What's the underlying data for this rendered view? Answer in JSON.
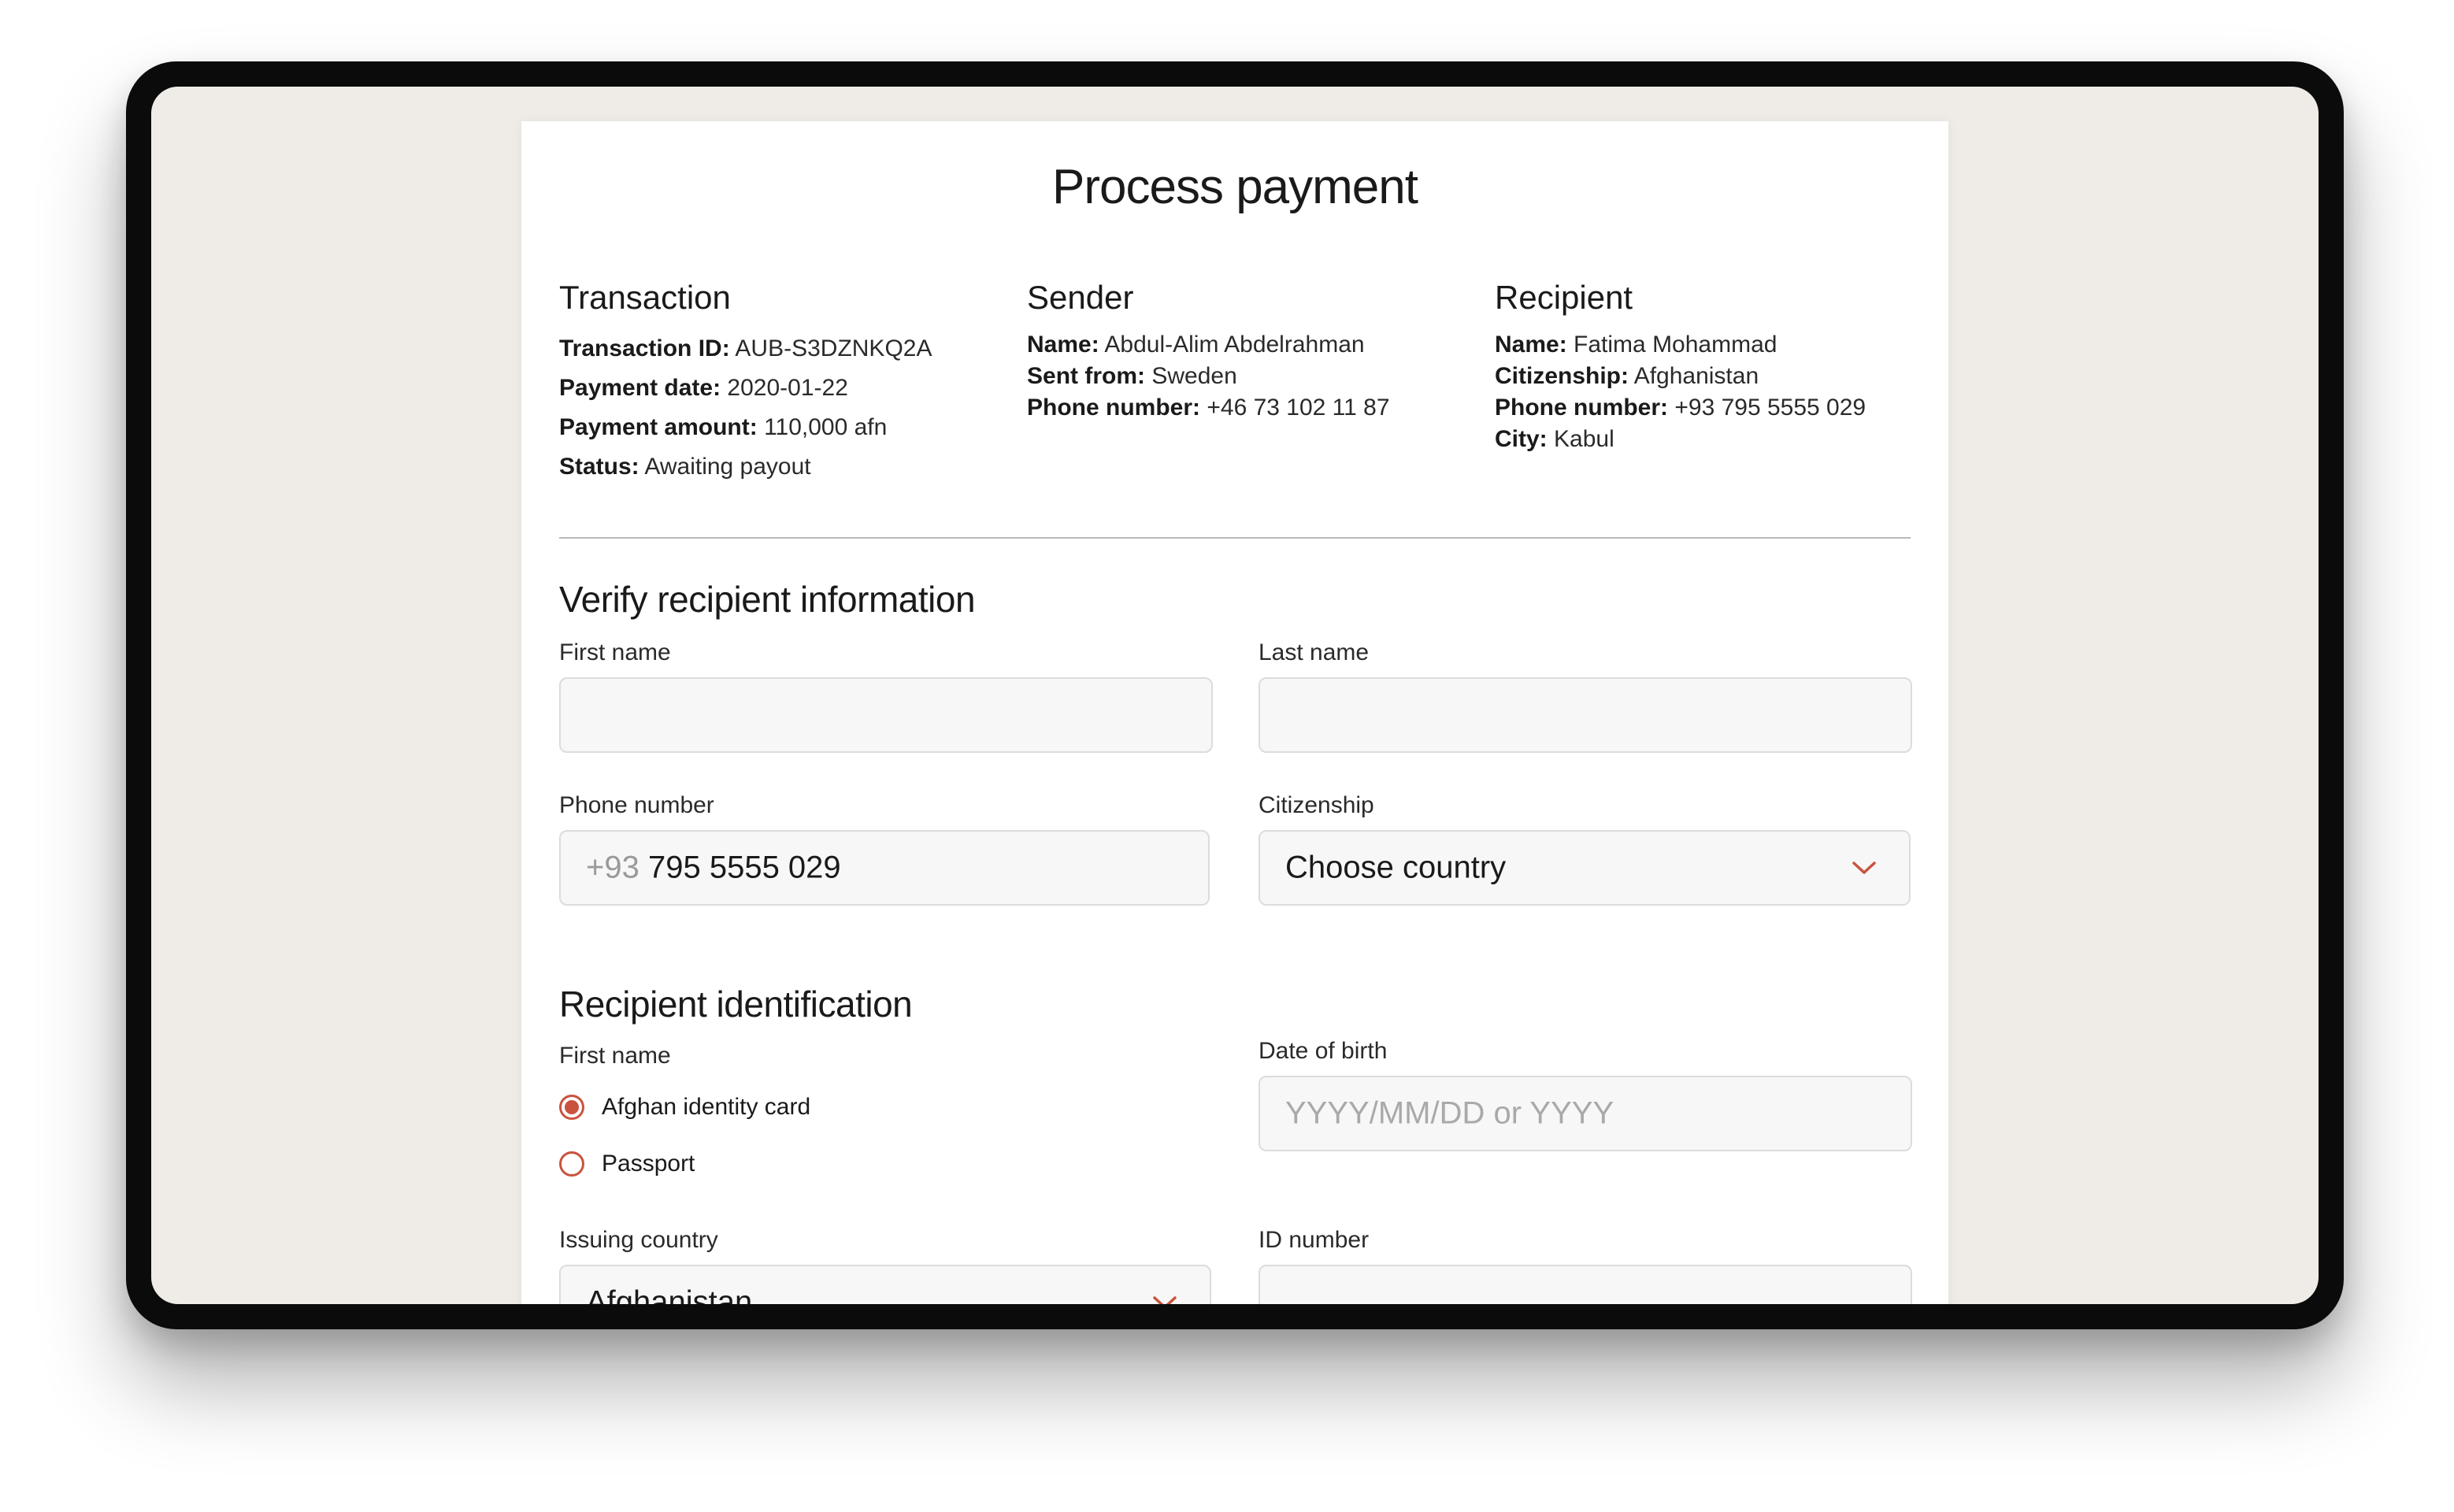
{
  "title": "Process payment",
  "transaction": {
    "heading": "Transaction",
    "rows": [
      {
        "label": "Transaction ID:",
        "value": "AUB-S3DZNKQ2A"
      },
      {
        "label": "Payment date:",
        "value": "2020-01-22"
      },
      {
        "label": "Payment amount:",
        "value": "110,000 afn"
      },
      {
        "label": "Status:",
        "value": "Awaiting payout"
      }
    ]
  },
  "sender": {
    "heading": "Sender",
    "rows": [
      {
        "label": "Name:",
        "value": "Abdul-Alim Abdelrahman"
      },
      {
        "label": "Sent from:",
        "value": "Sweden"
      },
      {
        "label": "Phone number:",
        "value": "+46 73 102 11 87"
      }
    ]
  },
  "recipient": {
    "heading": "Recipient",
    "rows": [
      {
        "label": "Name:",
        "value": "Fatima Mohammad"
      },
      {
        "label": "Citizenship:",
        "value": "Afghanistan"
      },
      {
        "label": "Phone number:",
        "value": "+93 795 5555 029"
      },
      {
        "label": "City:",
        "value": "Kabul"
      }
    ]
  },
  "verify": {
    "heading": "Verify recipient information",
    "first_name": {
      "label": "First name",
      "value": ""
    },
    "last_name": {
      "label": "Last name",
      "value": ""
    },
    "phone": {
      "label": "Phone number",
      "prefix": "+93",
      "value": "795 5555 029"
    },
    "citizenship": {
      "label": "Citizenship",
      "value": "Choose country"
    }
  },
  "identification": {
    "heading": "Recipient identification",
    "id_type_label": "First name",
    "options": [
      {
        "label": "Afghan identity card",
        "checked": true
      },
      {
        "label": "Passport",
        "checked": false
      }
    ],
    "dob": {
      "label": "Date of birth",
      "placeholder": "YYYY/MM/DD or YYYY"
    },
    "issuing_country": {
      "label": "Issuing country",
      "value": "Afghanistan"
    },
    "id_number": {
      "label": "ID number",
      "value": ""
    }
  },
  "colors": {
    "accent": "#c9533f",
    "screen_bg": "#efebe6",
    "card_bg": "#ffffff",
    "field_bg": "#f7f7f7"
  },
  "icons": {
    "dropdown": "chevron-down-icon"
  }
}
